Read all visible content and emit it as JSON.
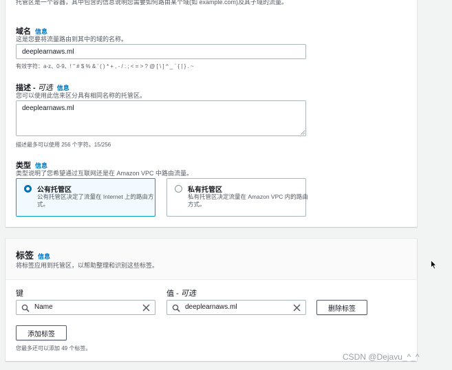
{
  "hosted_zone": {
    "top_description": "托管区是一个容器，其中包含的信息说明您需要如何路由某个域(如 example.com)及其子域的流量。",
    "domain_name": {
      "label": "域名",
      "info": "信息",
      "description": "这是您要将流量路由到其中的域的名称。",
      "value": "deeplearnaws.ml",
      "valid_chars": "有效字符：a-z、0-9、! \" # $ % & ' ( ) * + , - / : ; < = > ? @ [ \\ ] ^ _ ` { | } . ~"
    },
    "description_field": {
      "label": "描述 - ",
      "label_optional": "可选",
      "info": "信息",
      "description": "您可以使用此信来区分具有相同名称的托管区。",
      "value": "deeplearnaws.ml",
      "hint": "描述最多可以使用 256 个字符。15/256"
    },
    "type": {
      "label": "类型",
      "info": "信息",
      "description": "类型说明了您希望通过互联网还是在 Amazon VPC 中路由流量。",
      "options": [
        {
          "title": "公有托管区",
          "desc": "公有托管区决定了流量在 Internet 上的路由方式。",
          "selected": true
        },
        {
          "title": "私有托管区",
          "desc": "私有托管区决定流量在 Amazon VPC 内的路由方式。",
          "selected": false
        }
      ]
    }
  },
  "tags": {
    "title": "标签",
    "info": "信息",
    "description": "将标签应用到托管区，以帮助整理和识别这些标签。",
    "key_label": "键",
    "value_label": "值 - ",
    "value_label_optional": "可选",
    "key_value": "Name",
    "value_value": "deeplearnaws.ml",
    "remove_button": "删除标签",
    "add_button": "添加标签",
    "remaining_hint": "您最多还可以添加 49 个标签。"
  },
  "watermark": "CSDN @Dejavu_^_^",
  "colors": {
    "accent": "#0073bb",
    "selected_border": "#00a1c9",
    "background": "#f2f3f3"
  },
  "icons": [
    "search-icon",
    "close-icon",
    "mouse-cursor-icon",
    "resize-handle-icon",
    "radio-icon"
  ]
}
